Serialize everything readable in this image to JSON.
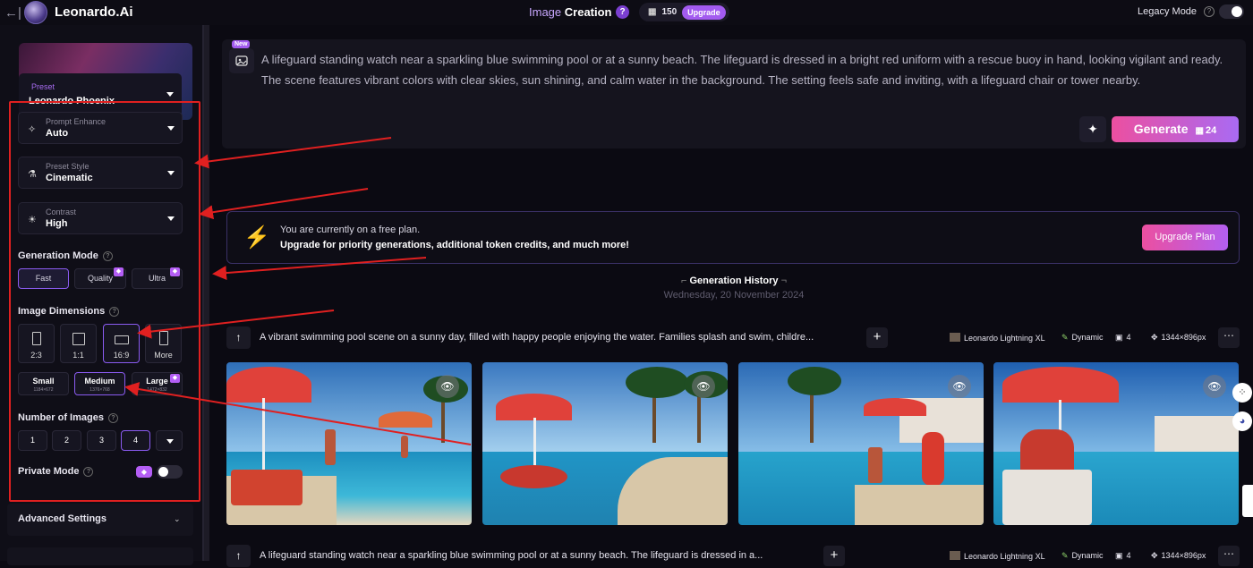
{
  "topbar": {
    "back_icon": "←|",
    "brand_name": "Leonardo",
    "brand_suffix": ".Ai",
    "title_prefix": "Image",
    "title_main": "Creation",
    "help": "?",
    "tokens": "150",
    "upgrade": "Upgrade",
    "legacy_label": "Legacy Mode",
    "legacy_help": "?"
  },
  "sidebar": {
    "preset_label": "Preset",
    "preset_value": "Leonardo Phoenix",
    "prompt_enhance": {
      "label": "Prompt Enhance",
      "value": "Auto"
    },
    "preset_style": {
      "label": "Preset Style",
      "value": "Cinematic"
    },
    "contrast": {
      "label": "Contrast",
      "value": "High"
    },
    "generation_mode_title": "Generation Mode",
    "modes": [
      "Fast",
      "Quality",
      "Ultra"
    ],
    "image_dimensions_title": "Image Dimensions",
    "dimensions": [
      "2:3",
      "1:1",
      "16:9",
      "More"
    ],
    "sizes": [
      {
        "label": "Small",
        "res": "1184×672"
      },
      {
        "label": "Medium",
        "res": "1376×768"
      },
      {
        "label": "Large",
        "res": "1472×832"
      }
    ],
    "number_of_images_title": "Number of Images",
    "numbers": [
      "1",
      "2",
      "3",
      "4"
    ],
    "private_mode": "Private Mode",
    "advanced_settings": "Advanced Settings"
  },
  "prompt": {
    "new_badge": "New",
    "text": "A lifeguard standing watch near a sparkling blue swimming pool or at a sunny beach. The lifeguard is dressed in a bright red uniform with a rescue buoy in hand, looking vigilant and ready. The scene features vibrant colors with clear skies, sun shining, and calm water in the background. The setting feels safe and inviting, with a lifeguard chair or tower nearby.",
    "generate_label": "Generate",
    "generate_cost": "24"
  },
  "plan": {
    "line1": "You are currently on a free plan.",
    "line2": "Upgrade for priority generations, additional token credits, and much more!",
    "button": "Upgrade Plan"
  },
  "history": {
    "title": "Generation History",
    "date": "Wednesday, 20 November 2024",
    "rows": [
      {
        "prompt": "A vibrant swimming pool scene on a sunny day, filled with happy people enjoying the water. Families splash and swim, childre...",
        "model": "Leonardo Lightning XL",
        "style": "Dynamic",
        "count": "4",
        "size": "1344×896px"
      },
      {
        "prompt": "A lifeguard standing watch near a sparkling blue swimming pool or at a sunny beach. The lifeguard is dressed in a...",
        "model": "Leonardo Lightning XL",
        "style": "Dynamic",
        "count": "4",
        "size": "1344×896px"
      }
    ]
  },
  "colors": {
    "accent": "#a35bf0",
    "generate_gradient_start": "#ec4fa0",
    "annotation_red": "#e02020"
  }
}
